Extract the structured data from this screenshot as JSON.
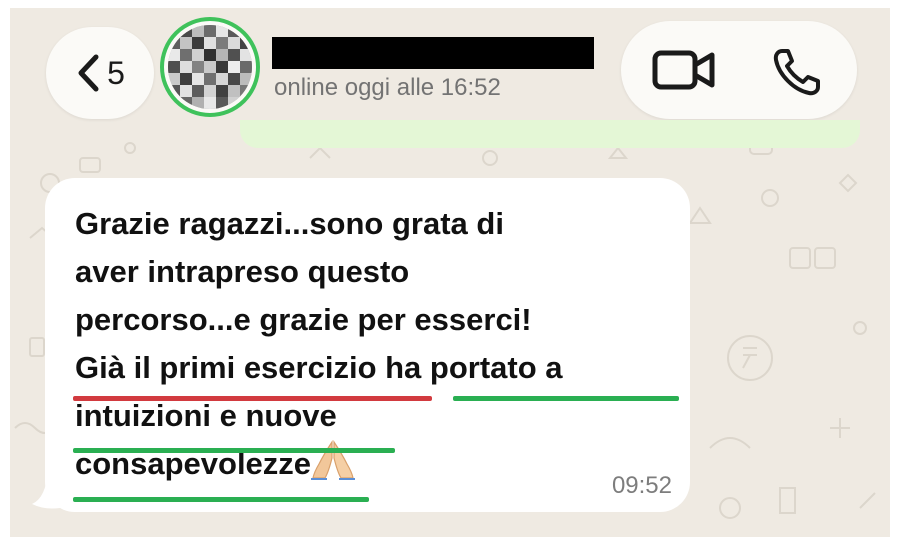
{
  "header": {
    "back_count": "5",
    "status": "online oggi alle 16:52"
  },
  "message": {
    "lines": [
      "Grazie ragazzi...sono grata di",
      "aver intrapreso questo",
      "percorso...e grazie per esserci!",
      "Già il primi esercizio ha portato a",
      "intuizioni e nuove",
      "consapevolezze"
    ],
    "time": "09:52",
    "emoji": "folded-hands"
  },
  "colors": {
    "chat_background": "#efeae2",
    "bubble": "#ffffff",
    "avatar_ring": "#3fc25b",
    "underline_red": "#d23a3f",
    "underline_green": "#2aaf52"
  }
}
